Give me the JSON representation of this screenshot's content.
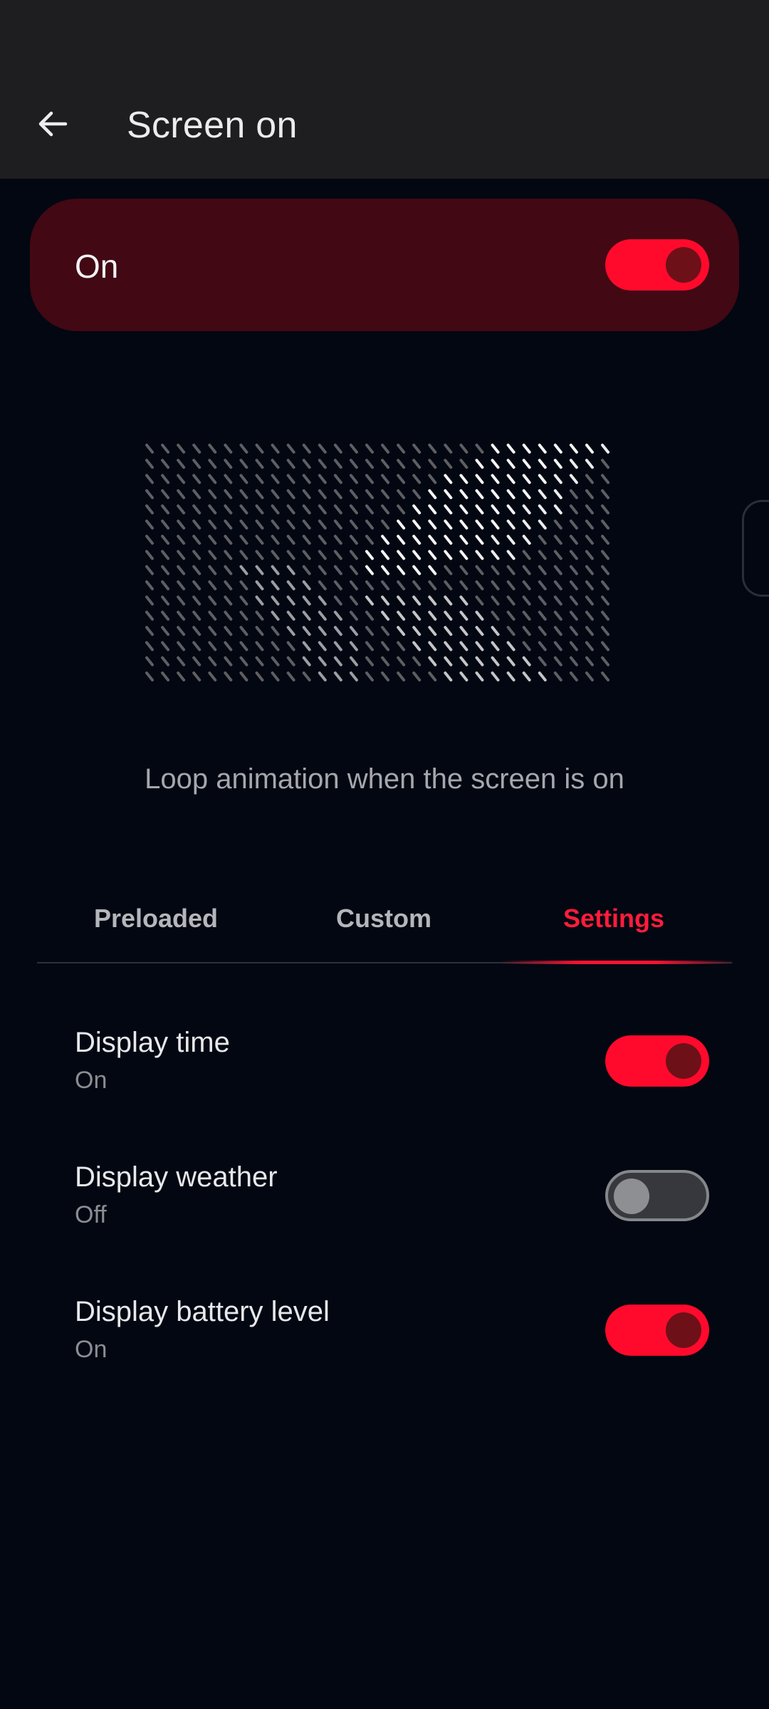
{
  "app_bar": {
    "title": "Screen on",
    "back_icon": "arrow-left-icon"
  },
  "master_switch": {
    "label": "On",
    "state": "on"
  },
  "preview": {
    "caption": "Loop animation when the screen is on"
  },
  "tabs": [
    {
      "label": "Preloaded",
      "active": false
    },
    {
      "label": "Custom",
      "active": false
    },
    {
      "label": "Settings",
      "active": true
    }
  ],
  "settings": [
    {
      "title": "Display time",
      "status": "On",
      "enabled": true
    },
    {
      "title": "Display weather",
      "status": "Off",
      "enabled": false
    },
    {
      "title": "Display battery level",
      "status": "On",
      "enabled": true
    }
  ],
  "colors": {
    "accent": "#ff0a2c",
    "card_background": "#420814",
    "page_background": "#030711",
    "app_bar_background": "#1e1e20"
  }
}
